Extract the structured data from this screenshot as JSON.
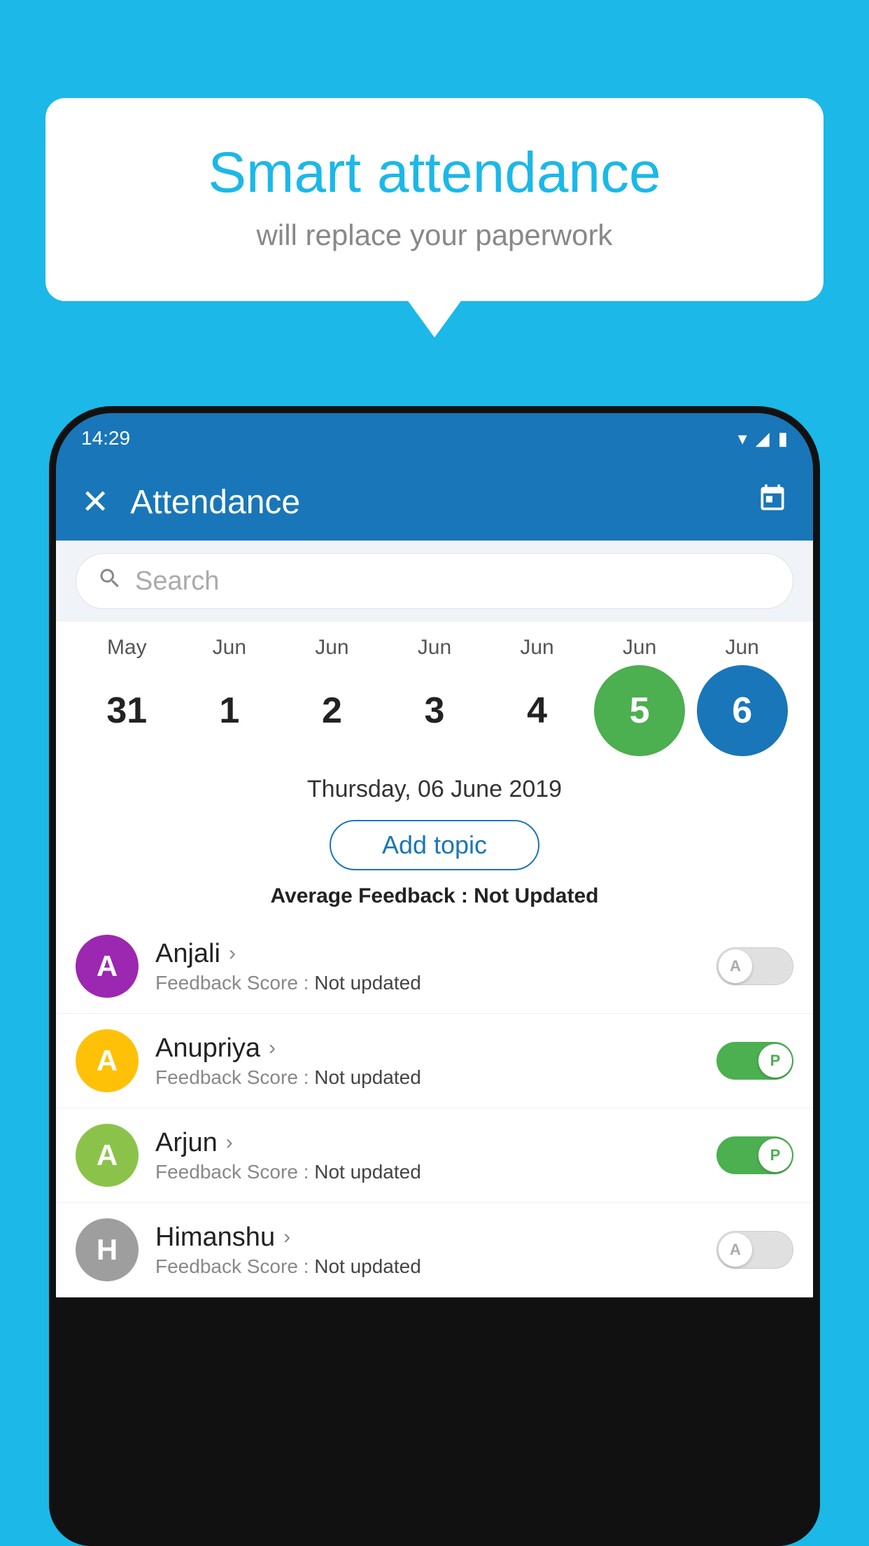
{
  "background": {
    "color": "#1bb8e8"
  },
  "speech_bubble": {
    "title": "Smart attendance",
    "subtitle": "will replace your paperwork"
  },
  "status_bar": {
    "time": "14:29",
    "wifi_icon": "▼",
    "signal_icon": "▲",
    "battery_icon": "▮"
  },
  "app_bar": {
    "close_icon": "✕",
    "title": "Attendance",
    "calendar_icon": "📅"
  },
  "search": {
    "placeholder": "Search"
  },
  "calendar": {
    "months": [
      "May",
      "Jun",
      "Jun",
      "Jun",
      "Jun",
      "Jun",
      "Jun"
    ],
    "days": [
      "31",
      "1",
      "2",
      "3",
      "4",
      "5",
      "6"
    ],
    "today_index": 5,
    "selected_index": 6
  },
  "selected_date": "Thursday, 06 June 2019",
  "add_topic_label": "Add topic",
  "average_feedback": {
    "label": "Average Feedback : ",
    "value": "Not Updated"
  },
  "students": [
    {
      "name": "Anjali",
      "avatar_letter": "A",
      "avatar_color": "#9c27b0",
      "feedback_label": "Feedback Score : ",
      "feedback_value": "Not updated",
      "attendance": "absent",
      "toggle_letter": "A"
    },
    {
      "name": "Anupriya",
      "avatar_letter": "A",
      "avatar_color": "#ffc107",
      "feedback_label": "Feedback Score : ",
      "feedback_value": "Not updated",
      "attendance": "present",
      "toggle_letter": "P"
    },
    {
      "name": "Arjun",
      "avatar_letter": "A",
      "avatar_color": "#8bc34a",
      "feedback_label": "Feedback Score : ",
      "feedback_value": "Not updated",
      "attendance": "present",
      "toggle_letter": "P"
    },
    {
      "name": "Himanshu",
      "avatar_letter": "H",
      "avatar_color": "#9e9e9e",
      "feedback_label": "Feedback Score : ",
      "feedback_value": "Not updated",
      "attendance": "absent",
      "toggle_letter": "A"
    }
  ]
}
